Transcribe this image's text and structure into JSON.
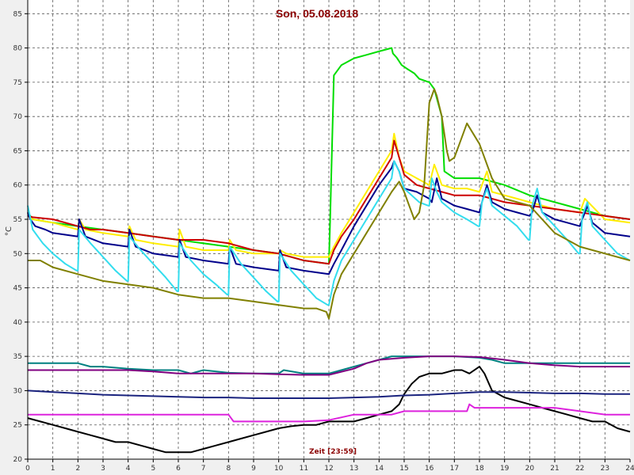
{
  "chart_data": {
    "type": "line",
    "title": "Son, 05.08.2018",
    "xlabel": "Zeit [23:59]",
    "ylabel": "°C",
    "xlim": [
      0,
      24
    ],
    "ylim": [
      20,
      87
    ],
    "xticks": [
      0,
      1,
      2,
      3,
      4,
      5,
      6,
      7,
      8,
      9,
      10,
      11,
      12,
      13,
      14,
      15,
      16,
      17,
      18,
      19,
      20,
      21,
      22,
      23,
      24
    ],
    "yticks": [
      20,
      25,
      30,
      35,
      40,
      45,
      50,
      55,
      60,
      65,
      70,
      75,
      80,
      85
    ],
    "grid": true,
    "series": [
      {
        "color": "#00dd00",
        "x": [
          0,
          0.2,
          1,
          2,
          4,
          6,
          8,
          10,
          11,
          12,
          12.05,
          12.2,
          12.5,
          13,
          13.5,
          14,
          14.5,
          14.55,
          14.7,
          14.9,
          15.1,
          15.4,
          15.6,
          16,
          16.2,
          16.5,
          16.6,
          17,
          17.5,
          18,
          18.5,
          19,
          20,
          21,
          22,
          23,
          24
        ],
        "y": [
          56,
          55,
          54.5,
          54,
          53,
          52,
          51,
          50,
          49,
          48.5,
          55,
          76,
          77.5,
          78.5,
          79,
          79.5,
          80,
          79.2,
          78.6,
          77.5,
          77,
          76.3,
          75.5,
          75,
          74,
          70,
          62,
          61,
          61,
          61,
          60.5,
          60,
          58.5,
          57.5,
          56.5,
          55.5,
          55
        ]
      },
      {
        "color": "#ffee00",
        "x": [
          0,
          0.2,
          1,
          2,
          2.05,
          2.3,
          3,
          4,
          4.05,
          4.3,
          5,
          6,
          6.05,
          6.3,
          7,
          8,
          8.05,
          8.3,
          9,
          10,
          10.05,
          10.3,
          11,
          12,
          12.2,
          12.5,
          13,
          13.5,
          14,
          14.5,
          14.6,
          14.8,
          15,
          15.5,
          16,
          16.2,
          16.3,
          16.5,
          17,
          17.5,
          18,
          18.3,
          18.5,
          19,
          19.5,
          20,
          21,
          22,
          22.2,
          23,
          24
        ],
        "y": [
          55.5,
          55,
          54.5,
          53.5,
          55,
          53.5,
          53,
          52.5,
          54,
          52,
          51.5,
          51,
          53.5,
          51,
          50.5,
          50.5,
          52,
          50.5,
          50,
          50,
          50.5,
          50,
          49.5,
          49.5,
          51,
          53,
          56,
          59,
          62,
          65,
          67.5,
          64,
          62,
          61,
          60,
          63,
          62,
          60,
          59.5,
          59.5,
          59,
          62,
          59,
          58.5,
          58,
          57.5,
          56.5,
          56,
          58,
          55,
          54.5
        ]
      },
      {
        "color": "#cc0000",
        "x": [
          0,
          0.2,
          1,
          2,
          2.5,
          3,
          4,
          5,
          6,
          7,
          8,
          9,
          10,
          11,
          12,
          12.2,
          12.5,
          13,
          13.5,
          14,
          14.5,
          14.6,
          14.8,
          15,
          15.5,
          16,
          16.5,
          17,
          17.5,
          18,
          18.5,
          19,
          20,
          21,
          22,
          23,
          24
        ],
        "y": [
          55.5,
          55.3,
          55,
          54,
          53.5,
          53.5,
          53,
          52.5,
          52,
          52,
          51.5,
          50.5,
          50,
          49,
          48.5,
          50.5,
          52.5,
          55,
          58,
          61,
          64,
          66.5,
          64,
          61.5,
          60,
          59.5,
          59,
          58.5,
          58.5,
          58.5,
          58,
          57.5,
          57,
          56.5,
          56,
          55.5,
          55
        ]
      },
      {
        "color": "#00008b",
        "x": [
          0,
          0.1,
          0.3,
          0.7,
          1,
          2,
          2.05,
          2.3,
          3,
          4,
          4.05,
          4.3,
          5,
          6,
          6.05,
          6.3,
          7,
          8,
          8.05,
          8.3,
          9,
          10,
          10.05,
          10.3,
          11,
          12,
          12.2,
          12.5,
          13,
          13.5,
          14,
          14.5,
          14.6,
          14.8,
          15,
          15.5,
          16,
          16.1,
          16.3,
          16.5,
          17,
          17.5,
          18,
          18.1,
          18.3,
          18.5,
          19,
          19.5,
          20,
          20.1,
          20.3,
          20.5,
          21,
          21.5,
          22,
          22.1,
          22.3,
          22.5,
          23,
          24
        ],
        "y": [
          56,
          55,
          54,
          53.5,
          53,
          52.5,
          55,
          52.5,
          51.5,
          51,
          53.5,
          51,
          50,
          49.5,
          52,
          49.5,
          49,
          48.5,
          51,
          48.5,
          48,
          47.5,
          50.5,
          48,
          47.5,
          47,
          48.5,
          50.5,
          54,
          57,
          60,
          62.5,
          63.5,
          62,
          59.5,
          59,
          58,
          57.5,
          61,
          58,
          57,
          56.5,
          56,
          57.5,
          60,
          57.5,
          56.5,
          56,
          55.5,
          56,
          58.5,
          56,
          55,
          54.5,
          54,
          55,
          57,
          54.5,
          53,
          52.5
        ]
      },
      {
        "color": "#33ddee",
        "x": [
          0,
          0.2,
          0.6,
          1,
          1.5,
          1.95,
          2,
          2.05,
          2.5,
          3,
          3.5,
          3.95,
          4,
          4.05,
          4.5,
          5,
          5.5,
          5.95,
          6,
          6.05,
          6.5,
          7,
          7.5,
          7.95,
          8,
          8.05,
          8.5,
          9,
          9.5,
          9.95,
          10,
          10.05,
          10.5,
          11,
          11.5,
          11.95,
          12,
          12.2,
          12.5,
          13,
          13.5,
          14,
          14.5,
          14.6,
          14.8,
          15,
          15.3,
          15.6,
          15.95,
          16,
          16.1,
          16.3,
          16.5,
          17,
          17.5,
          17.95,
          18,
          18.1,
          18.3,
          18.5,
          19,
          19.5,
          19.95,
          20,
          20.1,
          20.3,
          20.5,
          21,
          21.5,
          21.95,
          22,
          22.1,
          22.3,
          22.5,
          23,
          23.5,
          24
        ],
        "y": [
          57,
          53.5,
          51.5,
          50,
          48.5,
          47.5,
          47.5,
          53.5,
          51.5,
          49.5,
          47.5,
          46,
          46,
          52.5,
          50.5,
          48.5,
          46.5,
          44.5,
          44.5,
          51.5,
          49,
          47,
          45.5,
          44,
          44,
          51,
          48.5,
          46.5,
          44.5,
          43,
          43,
          50,
          47.5,
          45.5,
          43.5,
          42.5,
          42.5,
          46,
          49,
          52,
          55,
          58,
          61,
          63.5,
          62,
          59.5,
          58.5,
          57.5,
          57,
          57,
          61,
          59,
          57.5,
          56,
          55,
          54,
          54,
          57.5,
          59.5,
          57,
          55.5,
          54,
          52,
          52,
          57,
          59.5,
          56,
          54,
          52,
          50,
          50,
          55.5,
          57.5,
          54,
          52,
          50,
          49
        ]
      },
      {
        "color": "#808000",
        "x": [
          0,
          0.5,
          1,
          2,
          3,
          4,
          5,
          6,
          7,
          8,
          9,
          10,
          11,
          11.5,
          11.9,
          12,
          12.2,
          12.5,
          13,
          13.5,
          14,
          14.5,
          14.8,
          15,
          15.2,
          15.4,
          15.6,
          15.8,
          16,
          16.2,
          16.3,
          16.5,
          16.7,
          16.8,
          17,
          17.2,
          17.5,
          18,
          18.5,
          19,
          20,
          21,
          22,
          23,
          24
        ],
        "y": [
          49,
          49,
          48,
          47,
          46,
          45.5,
          45,
          44,
          43.5,
          43.5,
          43,
          42.5,
          42,
          42,
          41.5,
          40.5,
          44,
          47,
          50,
          53,
          56,
          59,
          60.5,
          59,
          57,
          55,
          56,
          60,
          72,
          74,
          73,
          70,
          65,
          63.5,
          64,
          66,
          69,
          66,
          61,
          58,
          57,
          53,
          51,
          50,
          49
        ]
      },
      {
        "color": "#008080",
        "x": [
          0,
          0.5,
          1,
          2,
          2.5,
          3,
          4,
          5,
          6,
          6.5,
          7,
          8,
          9,
          10,
          10.2,
          11,
          12,
          12.5,
          13,
          13.5,
          14,
          14.5,
          15,
          16,
          17,
          18,
          18.5,
          19,
          20,
          21,
          22,
          23,
          24
        ],
        "y": [
          34,
          34,
          34,
          34,
          33.5,
          33.5,
          33.2,
          33,
          33,
          32.5,
          33,
          32.6,
          32.5,
          32.5,
          33,
          32.5,
          32.5,
          33,
          33.5,
          34,
          34.5,
          35,
          35,
          35,
          35,
          34.8,
          34.5,
          34,
          34,
          34,
          34,
          34,
          34
        ]
      },
      {
        "color": "#800080",
        "x": [
          0,
          1,
          2,
          3,
          4,
          5,
          6,
          7,
          8,
          9,
          10,
          11,
          12,
          13,
          13.5,
          14,
          15,
          16,
          17,
          18,
          19,
          20,
          21,
          22,
          23,
          24
        ],
        "y": [
          33,
          33,
          33,
          33,
          33,
          32.8,
          32.5,
          32.5,
          32.5,
          32.5,
          32.4,
          32.3,
          32.3,
          33.2,
          34,
          34.5,
          34.8,
          35,
          35,
          34.9,
          34.5,
          34,
          33.7,
          33.5,
          33.5,
          33.5
        ]
      },
      {
        "color": "#000000",
        "x": [
          0,
          0.5,
          1,
          1.5,
          2,
          2.5,
          3,
          3.5,
          4,
          4.5,
          5,
          5.5,
          6,
          6.5,
          7,
          7.5,
          8,
          8.5,
          9,
          9.5,
          10,
          10.5,
          11,
          11.5,
          12,
          12.5,
          13,
          13.5,
          14,
          14.5,
          14.8,
          15,
          15.3,
          15.6,
          16,
          16.5,
          17,
          17.3,
          17.6,
          18,
          18.2,
          18.5,
          19,
          19.5,
          20,
          20.5,
          21,
          21.5,
          22,
          22.5,
          23,
          23.5,
          24
        ],
        "y": [
          26,
          25.5,
          25,
          24.5,
          24,
          23.5,
          23,
          22.5,
          22.5,
          22,
          21.5,
          21,
          21,
          21,
          21.5,
          22,
          22.5,
          23,
          23.5,
          24,
          24.5,
          24.8,
          25,
          25,
          25.5,
          25.5,
          25.5,
          26,
          26.5,
          27,
          28,
          29.5,
          31,
          32,
          32.5,
          32.5,
          33,
          33,
          32.5,
          33.5,
          32.5,
          30,
          29,
          28.5,
          28,
          27.5,
          27,
          26.5,
          26,
          25.5,
          25.5,
          24.5,
          24
        ]
      },
      {
        "color": "#1a237e",
        "x": [
          0,
          1,
          2,
          3,
          4,
          5,
          6,
          7,
          8,
          9,
          10,
          11,
          12,
          13,
          14,
          15,
          16,
          17,
          18,
          19,
          20,
          21,
          22,
          23,
          24
        ],
        "y": [
          30,
          29.8,
          29.6,
          29.4,
          29.3,
          29.2,
          29.1,
          29,
          29,
          28.9,
          28.9,
          28.9,
          28.9,
          29,
          29.1,
          29.3,
          29.4,
          29.6,
          29.8,
          29.8,
          29.7,
          29.6,
          29.6,
          29.5,
          29.5
        ]
      },
      {
        "color": "#dd22dd",
        "x": [
          0,
          2,
          4,
          6,
          8,
          8.2,
          9,
          10,
          11,
          12,
          13,
          14,
          14.5,
          15,
          16,
          17,
          17.5,
          17.6,
          17.8,
          18,
          19,
          20,
          21,
          22,
          23,
          24
        ],
        "y": [
          26.5,
          26.5,
          26.5,
          26.5,
          26.5,
          25.5,
          25.5,
          25.5,
          25.5,
          25.7,
          26.5,
          26.5,
          26.5,
          27,
          27,
          27,
          27,
          28,
          27.5,
          27.5,
          27.5,
          27.5,
          27.5,
          27,
          26.5,
          26.5
        ]
      }
    ]
  }
}
